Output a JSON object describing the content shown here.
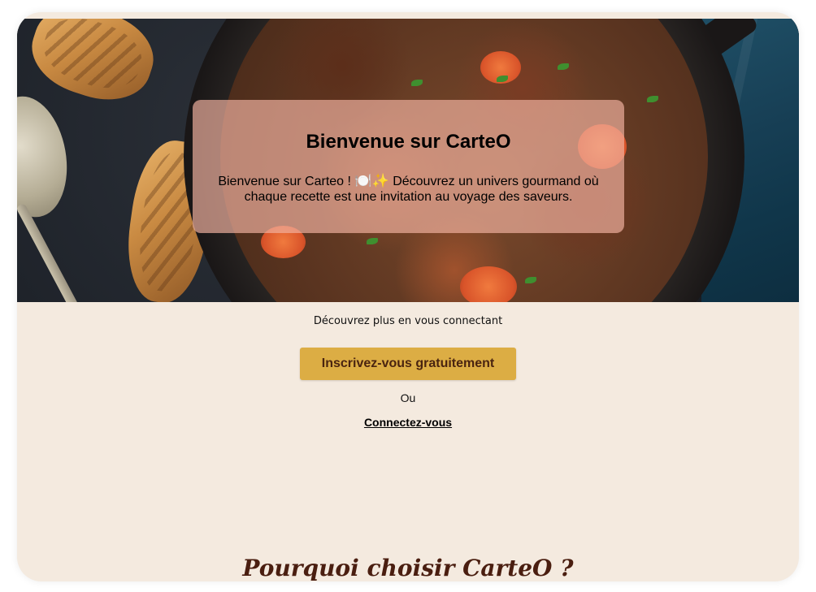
{
  "hero": {
    "title": "Bienvenue sur CarteO",
    "text_before": "Bienvenue sur Carteo ! ",
    "emoji_plate": "🍽️",
    "emoji_sparkles": "✨",
    "text_after": " Découvrez un univers gourmand où chaque recette est une invitation au voyage des saveurs.",
    "image_description": "beef-stew-in-cast-iron-pan"
  },
  "cta": {
    "subtitle": "Découvrez plus en vous connectant",
    "signup_label": "Inscrivez-vous gratuitement",
    "or_label": "Ou",
    "login_label": "Connectez-vous"
  },
  "section": {
    "title": "Pourquoi choisir CarteO ?"
  },
  "colors": {
    "background": "#f4eadf",
    "button": "#dcad44",
    "button_text": "#4a2410",
    "heading": "#4a1e10",
    "card_overlay": "rgba(242,178,160,0.68)"
  }
}
